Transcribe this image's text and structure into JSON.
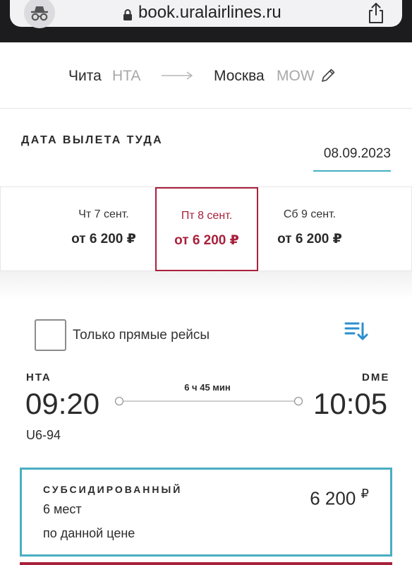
{
  "browser": {
    "url": "book.uralairlines.ru"
  },
  "route": {
    "from_city": "Чита",
    "from_code": "HTA",
    "to_city": "Москва",
    "to_code": "MOW"
  },
  "departure": {
    "label": "ДАТА ВЫЛЕТА ТУДА",
    "date": "08.09.2023"
  },
  "dates": [
    {
      "day": "Чт 7 сент.",
      "price": "от 6 200 ₽",
      "selected": false
    },
    {
      "day": "Пт 8 сент.",
      "price": "от 6 200 ₽",
      "selected": true
    },
    {
      "day": "Сб 9 сент.",
      "price": "от 6 200 ₽",
      "selected": false
    }
  ],
  "filters": {
    "direct_only_label": "Только прямые рейсы",
    "direct_only_checked": false
  },
  "flight": {
    "origin_code": "HTA",
    "destination_code": "DME",
    "departure_time": "09:20",
    "arrival_time": "10:05",
    "duration": "6 ч 45 мин",
    "flight_number": "U6-94"
  },
  "fare": {
    "name": "СУБСИДИРОВАННЫЙ",
    "seats": "6 мест",
    "note": "по данной цене",
    "price": "6 200",
    "currency": "₽"
  },
  "colors": {
    "accent_red": "#a8213c",
    "accent_teal": "#4aaec3",
    "sort_blue": "#2a8fd0"
  }
}
